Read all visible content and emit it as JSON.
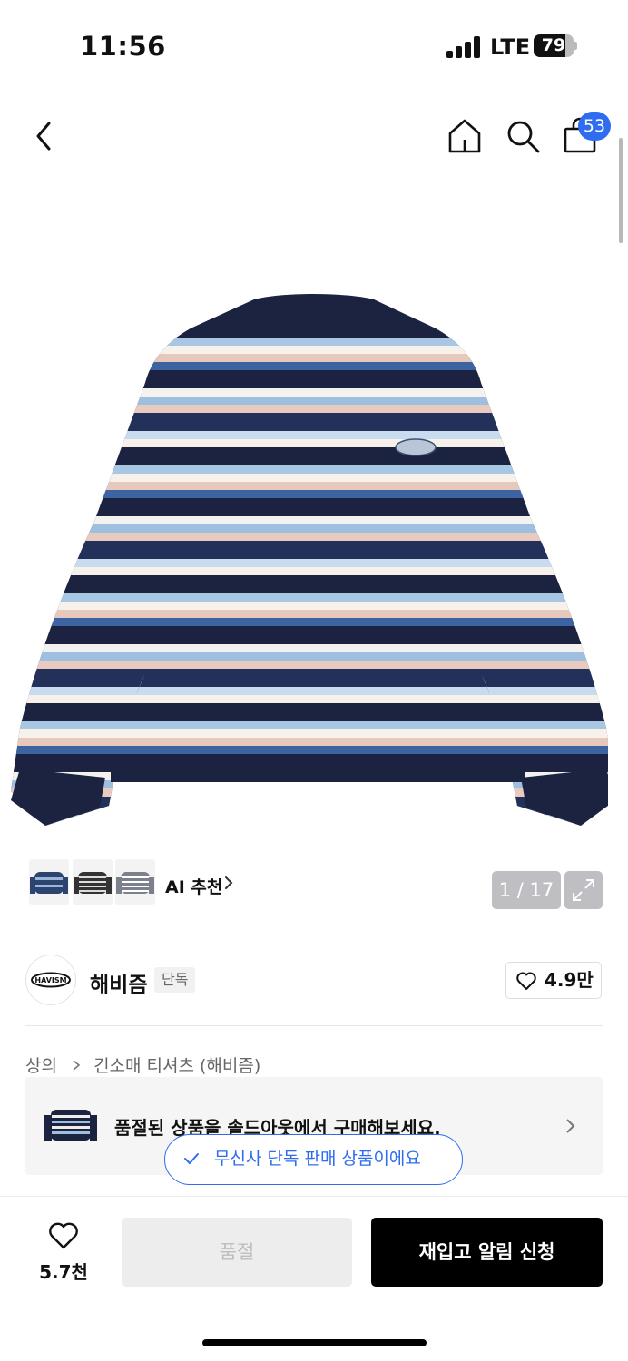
{
  "status_bar": {
    "time": "11:56",
    "network": "LTE",
    "battery": "79",
    "battery_level": 0.79
  },
  "nav": {
    "cart_count": "53"
  },
  "gallery": {
    "page_counter": "1 / 17",
    "ai_recommend_label": "AI 추천",
    "stripe_colors": [
      "#1c2340",
      "#a9c6e2",
      "#f6f1ea",
      "#e6c8bd",
      "#3e63a2",
      "#1c2340",
      "#f4f2ee",
      "#9fbfe0",
      "#e9cabf",
      "#22305a",
      "#c9dcef",
      "#f6f1ea"
    ]
  },
  "brand": {
    "name": "해비즘",
    "badge": "단독",
    "logo_text": "HAVISM",
    "likes": "4.9만"
  },
  "breadcrumb": {
    "items": [
      "상의",
      "긴소매 티셔츠 (해비즘)"
    ]
  },
  "soldout_card": {
    "text": "품절된 상품을 솔드아웃에서 구매해보세요."
  },
  "exclusive_chip": {
    "text": "무신사 단독 판매 상품이에요"
  },
  "bottom_bar": {
    "wish_count": "5.7천",
    "soldout_label": "품절",
    "restock_label": "재입고 알림 신청"
  }
}
